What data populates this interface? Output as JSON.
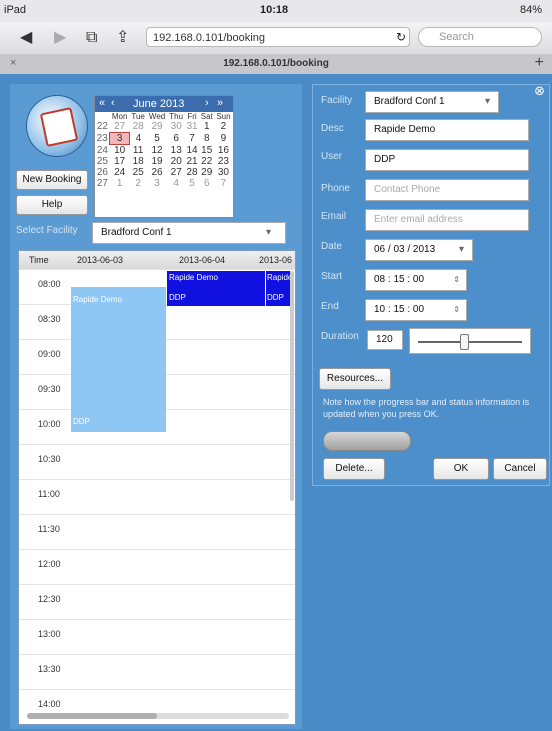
{
  "status": {
    "left": "iPad",
    "time": "10:18",
    "battery": "84%"
  },
  "browser": {
    "url": "192.168.0.101/booking",
    "search_placeholder": "Search",
    "tab_title": "192.168.0.101/booking"
  },
  "calendar": {
    "month": "June 2013",
    "prev_year": "«",
    "prev": "‹",
    "next": "›",
    "next_year": "»",
    "dow": [
      "Mon",
      "Tue",
      "Wed",
      "Thu",
      "Fri",
      "Sat",
      "Sun"
    ],
    "weeks": [
      [
        "22",
        "27",
        "28",
        "29",
        "30",
        "31",
        "1",
        "2"
      ],
      [
        "23",
        "3",
        "4",
        "5",
        "6",
        "7",
        "8",
        "9"
      ],
      [
        "24",
        "10",
        "11",
        "12",
        "13",
        "14",
        "15",
        "16"
      ],
      [
        "25",
        "17",
        "18",
        "19",
        "20",
        "21",
        "22",
        "23"
      ],
      [
        "26",
        "24",
        "25",
        "26",
        "27",
        "28",
        "29",
        "30"
      ],
      [
        "27",
        "1",
        "2",
        "3",
        "4",
        "5",
        "6",
        "7"
      ]
    ]
  },
  "left": {
    "new_booking": "New Booking",
    "help": "Help",
    "select_facility_label": "Select Facility",
    "facility_value": "Bradford Conf 1"
  },
  "grid": {
    "headers": [
      "Time",
      "2013-06-03",
      "2013-06-04",
      "2013-06"
    ],
    "times": [
      "08:00",
      "08:30",
      "09:00",
      "09:30",
      "10:00",
      "10:30",
      "11:00",
      "11:30",
      "12:00",
      "12:30",
      "13:00",
      "13:30",
      "14:00"
    ],
    "events": {
      "e1_top": "Rapide Demo",
      "e1_bottom": "DDP",
      "e2_top": "Rapide Demo",
      "e2_bottom": "DDP",
      "e3_top": "Rapide",
      "e3_bottom": "DDP"
    }
  },
  "form": {
    "facility_label": "Facility",
    "facility_value": "Bradford Conf 1",
    "desc_label": "Desc",
    "desc_value": "Rapide Demo",
    "user_label": "User",
    "user_value": "DDP",
    "phone_label": "Phone",
    "phone_placeholder": "Contact Phone",
    "email_label": "Email",
    "email_placeholder": "Enter email address",
    "date_label": "Date",
    "date_value": "06 / 03 / 2013",
    "start_label": "Start",
    "start_value": "08 : 15 : 00",
    "end_label": "End",
    "end_value": "10 : 15 : 00",
    "duration_label": "Duration",
    "duration_value": "120",
    "resources_button": "Resources...",
    "note": "Note how the progress bar and status information is updated when you press OK.",
    "delete_button": "Delete...",
    "ok_button": "OK",
    "cancel_button": "Cancel",
    "close_symbol": "⊗"
  }
}
